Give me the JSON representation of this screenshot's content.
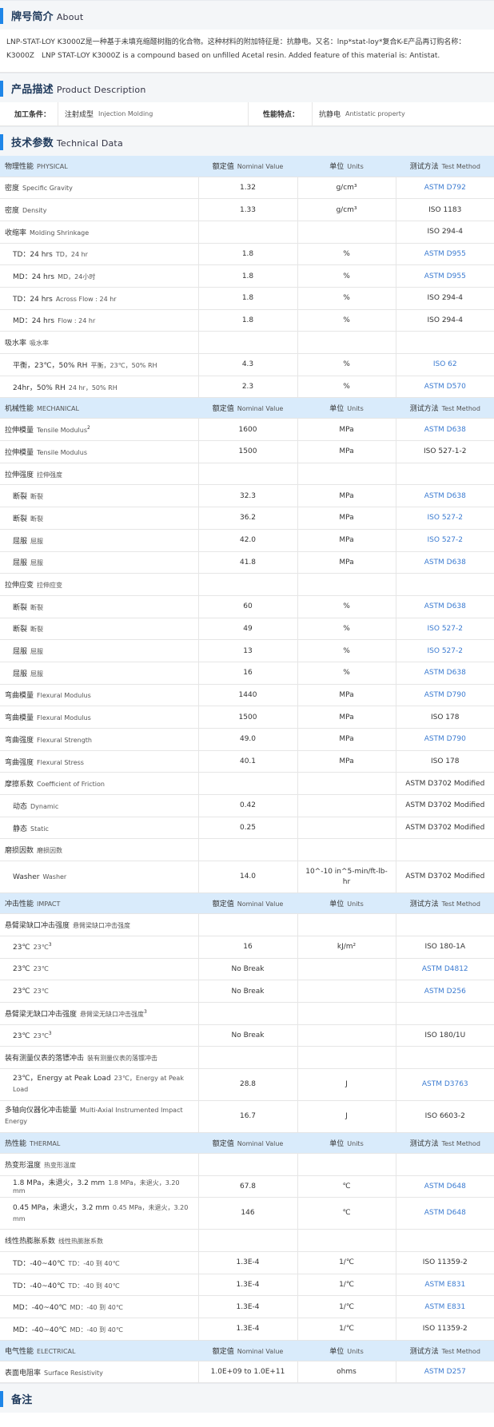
{
  "about": {
    "title_zh": "牌号简介",
    "title_en": "About",
    "text": "LNP-STAT-LOY K3000Z是一种基于未填充缩醛树脂的化合物。这种材料的附加特征是：抗静电。又名：lnp*stat-loy*复合K-E产品再订购名称：K3000Z　LNP STAT-LOY K3000Z is a compound based on unfilled Acetal resin. Added feature of this material is: Antistat."
  },
  "product_description": {
    "title_zh": "产品描述",
    "title_en": "Product Description",
    "processing_label": "加工条件：",
    "processing_zh": "注射成型",
    "processing_en": "Injection Molding",
    "feature_label": "性能特点：",
    "feature_zh": "抗静电",
    "feature_en": "Antistatic property"
  },
  "technical": {
    "title_zh": "技术参数",
    "title_en": "Technical Data",
    "col_nominal_zh": "额定值",
    "col_nominal_en": "Nominal Value",
    "col_units_zh": "单位",
    "col_units_en": "Units",
    "col_method_zh": "测试方法",
    "col_method_en": "Test Method",
    "groups": [
      {
        "zh": "物理性能",
        "en": "PHYSICAL",
        "rows": [
          {
            "zh": "密度",
            "en": "Specific Gravity",
            "value": "1.32",
            "unit": "g/cm³",
            "method": "ASTM D792",
            "link": true
          },
          {
            "zh": "密度",
            "en": "Density",
            "value": "1.33",
            "unit": "g/cm³",
            "method": "ISO 1183"
          },
          {
            "zh": "收缩率",
            "en": "Molding Shrinkage",
            "value": "",
            "unit": "",
            "method": "ISO 294-4"
          },
          {
            "zh": "TD：24 hrs",
            "en": "TD，24 hr",
            "value": "1.8",
            "unit": "%",
            "method": "ASTM D955",
            "link": true,
            "sub": true
          },
          {
            "zh": "MD：24 hrs",
            "en": "MD，24小时",
            "value": "1.8",
            "unit": "%",
            "method": "ASTM D955",
            "link": true,
            "sub": true
          },
          {
            "zh": "TD：24 hrs",
            "en": "Across Flow : 24 hr",
            "value": "1.8",
            "unit": "%",
            "method": "ISO 294-4",
            "sub": true
          },
          {
            "zh": "MD：24 hrs",
            "en": "Flow : 24 hr",
            "value": "1.8",
            "unit": "%",
            "method": "ISO 294-4",
            "sub": true
          },
          {
            "zh": "吸水率",
            "en": "吸水率",
            "value": "",
            "unit": "",
            "method": ""
          },
          {
            "zh": "平衡，23℃，50% RH",
            "en": "平衡，23℃，50% RH",
            "value": "4.3",
            "unit": "%",
            "method": "ISO 62",
            "link": true,
            "sub": true
          },
          {
            "zh": "24hr，50% RH",
            "en": "24 hr，50% RH",
            "value": "2.3",
            "unit": "%",
            "method": "ASTM D570",
            "link": true,
            "sub": true
          }
        ]
      },
      {
        "zh": "机械性能",
        "en": "MECHANICAL",
        "rows": [
          {
            "zh": "拉伸模量",
            "en": "Tensile Modulus",
            "sup": "2",
            "value": "1600",
            "unit": "MPa",
            "method": "ASTM D638",
            "link": true
          },
          {
            "zh": "拉伸模量",
            "en": "Tensile Modulus",
            "value": "1500",
            "unit": "MPa",
            "method": "ISO 527-1-2"
          },
          {
            "zh": "拉伸强度",
            "en": "拉伸强度",
            "value": "",
            "unit": "",
            "method": ""
          },
          {
            "zh": "断裂",
            "en": "断裂",
            "value": "32.3",
            "unit": "MPa",
            "method": "ASTM D638",
            "link": true,
            "sub": true
          },
          {
            "zh": "断裂",
            "en": "断裂",
            "value": "36.2",
            "unit": "MPa",
            "method": "ISO 527-2",
            "link": true,
            "sub": true
          },
          {
            "zh": "屈服",
            "en": "屈服",
            "value": "42.0",
            "unit": "MPa",
            "method": "ISO 527-2",
            "link": true,
            "sub": true
          },
          {
            "zh": "屈服",
            "en": "屈服",
            "value": "41.8",
            "unit": "MPa",
            "method": "ASTM D638",
            "link": true,
            "sub": true
          },
          {
            "zh": "拉伸应变",
            "en": "拉伸应变",
            "value": "",
            "unit": "",
            "method": ""
          },
          {
            "zh": "断裂",
            "en": "断裂",
            "value": "60",
            "unit": "%",
            "method": "ASTM D638",
            "link": true,
            "sub": true
          },
          {
            "zh": "断裂",
            "en": "断裂",
            "value": "49",
            "unit": "%",
            "method": "ISO 527-2",
            "link": true,
            "sub": true
          },
          {
            "zh": "屈服",
            "en": "屈服",
            "value": "13",
            "unit": "%",
            "method": "ISO 527-2",
            "link": true,
            "sub": true
          },
          {
            "zh": "屈服",
            "en": "屈服",
            "value": "16",
            "unit": "%",
            "method": "ASTM D638",
            "link": true,
            "sub": true
          },
          {
            "zh": "弯曲模量",
            "en": "Flexural Modulus",
            "value": "1440",
            "unit": "MPa",
            "method": "ASTM D790",
            "link": true
          },
          {
            "zh": "弯曲模量",
            "en": "Flexural Modulus",
            "value": "1500",
            "unit": "MPa",
            "method": "ISO 178"
          },
          {
            "zh": "弯曲强度",
            "en": "Flexural Strength",
            "value": "49.0",
            "unit": "MPa",
            "method": "ASTM D790",
            "link": true
          },
          {
            "zh": "弯曲强度",
            "en": "Flexural Stress",
            "value": "40.1",
            "unit": "MPa",
            "method": "ISO 178"
          },
          {
            "zh": "摩擦系数",
            "en": "Coefficient of Friction",
            "value": "",
            "unit": "",
            "method": "ASTM D3702 Modified"
          },
          {
            "zh": "动态",
            "en": "Dynamic",
            "value": "0.42",
            "unit": "",
            "method": "ASTM D3702 Modified",
            "sub": true
          },
          {
            "zh": "静态",
            "en": "Static",
            "value": "0.25",
            "unit": "",
            "method": "ASTM D3702 Modified",
            "sub": true
          },
          {
            "zh": "磨损因数",
            "en": "磨损因数",
            "value": "",
            "unit": "",
            "method": ""
          },
          {
            "zh": "Washer",
            "en": "Washer",
            "value": "14.0",
            "unit": "10^-10 in^5-min/ft-lb-hr",
            "method": "ASTM D3702 Modified",
            "sub": true,
            "tall": true
          }
        ]
      },
      {
        "zh": "冲击性能",
        "en": "IMPACT",
        "rows": [
          {
            "zh": "悬臂梁缺口冲击强度",
            "en": "悬臂梁缺口冲击强度",
            "value": "",
            "unit": "",
            "method": ""
          },
          {
            "zh": "23℃",
            "en": "23℃",
            "sup": "3",
            "value": "16",
            "unit": "kJ/m²",
            "method": "ISO 180-1A",
            "sub": true
          },
          {
            "zh": "23℃",
            "en": "23℃",
            "value": "No Break",
            "unit": "",
            "method": "ASTM D4812",
            "link": true,
            "sub": true
          },
          {
            "zh": "23℃",
            "en": "23℃",
            "value": "No Break",
            "unit": "",
            "method": "ASTM D256",
            "link": true,
            "sub": true
          },
          {
            "zh": "悬臂梁无缺口冲击强度",
            "en": "悬臂梁无缺口冲击强度",
            "sup": "3",
            "value": "",
            "unit": "",
            "method": ""
          },
          {
            "zh": "23℃",
            "en": "23℃",
            "sup": "3",
            "value": "No Break",
            "unit": "",
            "method": "ISO 180/1U",
            "sub": true
          },
          {
            "zh": "装有测量仪表的落镖冲击",
            "en": "装有测量仪表的落镖冲击",
            "value": "",
            "unit": "",
            "method": ""
          },
          {
            "zh": "23℃，Energy at Peak Load",
            "en": "23℃，Energy at Peak Load",
            "value": "28.8",
            "unit": "J",
            "method": "ASTM D3763",
            "link": true,
            "sub": true,
            "tall": true
          },
          {
            "zh": "多轴向仪器化冲击能量",
            "en": "Multi-Axial Instrumented Impact Energy",
            "value": "16.7",
            "unit": "J",
            "method": "ISO 6603-2",
            "tall": true
          }
        ]
      },
      {
        "zh": "热性能",
        "en": "THERMAL",
        "rows": [
          {
            "zh": "热变形温度",
            "en": "热变形温度",
            "value": "",
            "unit": "",
            "method": ""
          },
          {
            "zh": "1.8 MPa，未退火，3.2 mm",
            "en": "1.8 MPa，未退火，3.20 mm",
            "value": "67.8",
            "unit": "℃",
            "method": "ASTM D648",
            "link": true,
            "sub": true
          },
          {
            "zh": "0.45 MPa，未退火，3.2 mm",
            "en": "0.45 MPa，未退火，3.20 mm",
            "value": "146",
            "unit": "℃",
            "method": "ASTM D648",
            "link": true,
            "sub": true,
            "tall": true
          },
          {
            "zh": "线性热膨胀系数",
            "en": "线性热膨胀系数",
            "value": "",
            "unit": "",
            "method": ""
          },
          {
            "zh": "TD：-40~40℃",
            "en": "TD：-40 到 40℃",
            "value": "1.3E-4",
            "unit": "1/℃",
            "method": "ISO 11359-2",
            "sub": true
          },
          {
            "zh": "TD：-40~40℃",
            "en": "TD：-40 到 40℃",
            "value": "1.3E-4",
            "unit": "1/℃",
            "method": "ASTM E831",
            "link": true,
            "sub": true
          },
          {
            "zh": "MD：-40~40℃",
            "en": "MD：-40 到 40℃",
            "value": "1.3E-4",
            "unit": "1/℃",
            "method": "ASTM E831",
            "link": true,
            "sub": true
          },
          {
            "zh": "MD：-40~40℃",
            "en": "MD：-40 到 40℃",
            "value": "1.3E-4",
            "unit": "1/℃",
            "method": "ISO 11359-2",
            "sub": true
          }
        ]
      },
      {
        "zh": "电气性能",
        "en": "ELECTRICAL",
        "rows": [
          {
            "zh": "表面电阻率",
            "en": "Surface Resistivity",
            "value": "1.0E+09 to 1.0E+11",
            "unit": "ohms",
            "method": "ASTM D257",
            "link": true
          }
        ]
      }
    ]
  },
  "notes": {
    "title_zh": "备注"
  }
}
